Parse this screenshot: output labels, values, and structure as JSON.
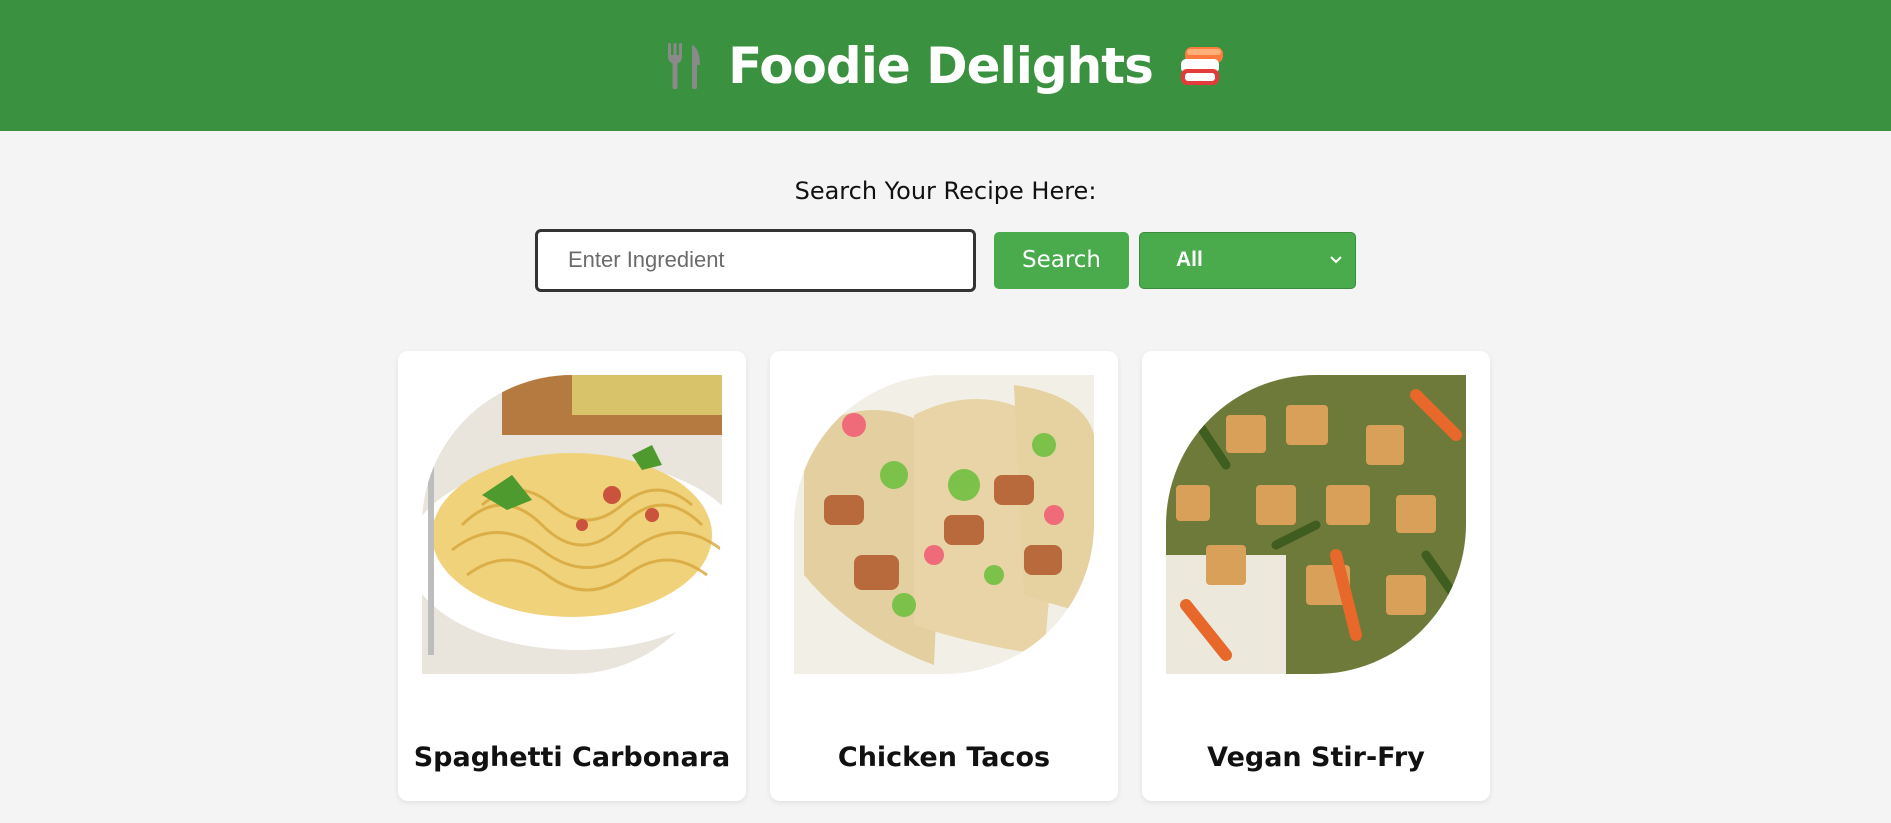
{
  "header": {
    "title": "Foodie Delights",
    "left_icon": "fork-knife-icon",
    "right_icon": "sushi-icon",
    "background": "#3a913f"
  },
  "search": {
    "heading": "Search Your Recipe Here:",
    "input_placeholder": "Enter Ingredient",
    "input_value": "",
    "button_label": "Search",
    "category_selected": "All",
    "accent": "#4aab4d"
  },
  "recipes": [
    {
      "title": "Spaghetti Carbonara",
      "image": "spaghetti-carbonara-photo"
    },
    {
      "title": "Chicken Tacos",
      "image": "chicken-tacos-photo"
    },
    {
      "title": "Vegan Stir-Fry",
      "image": "vegan-stir-fry-photo"
    }
  ]
}
